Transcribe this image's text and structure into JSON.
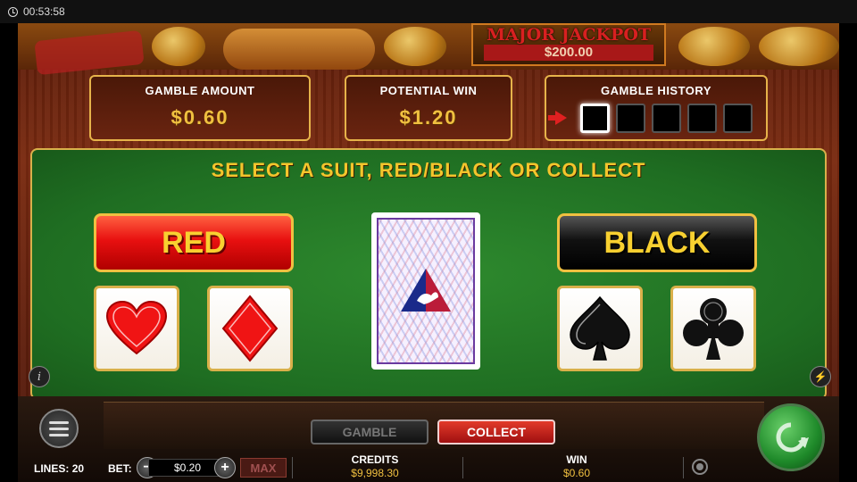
{
  "system_bar": {
    "time": "00:53:58"
  },
  "jackpot": {
    "title": "MAJOR JACKPOT",
    "value": "$200.00"
  },
  "panels": {
    "gamble_amount": {
      "label": "GAMBLE  AMOUNT",
      "value": "$0.60"
    },
    "potential_win": {
      "label": "POTENTIAL  WIN",
      "value": "$1.20"
    },
    "gamble_history": {
      "label": "GAMBLE  HISTORY",
      "slots": 5,
      "active_slot": 1
    }
  },
  "table": {
    "instruction": "SELECT A SUIT, RED/BLACK OR COLLECT",
    "red_button": "RED",
    "black_button": "BLACK",
    "suits": [
      "heart",
      "diamond",
      "spade",
      "club"
    ]
  },
  "controls": {
    "gamble": "GAMBLE",
    "collect": "COLLECT",
    "lines_label": "LINES:",
    "lines_value": "20",
    "bet_label": "BET:",
    "bet_value": "$0.20",
    "max": "MAX",
    "credits_label": "CREDITS",
    "credits_value": "$9,998.30",
    "win_label": "WIN",
    "win_value": "$0.60"
  },
  "colors": {
    "accent_gold": "#f0c040",
    "felt_green": "#1f6e22",
    "red": "#e81010"
  }
}
